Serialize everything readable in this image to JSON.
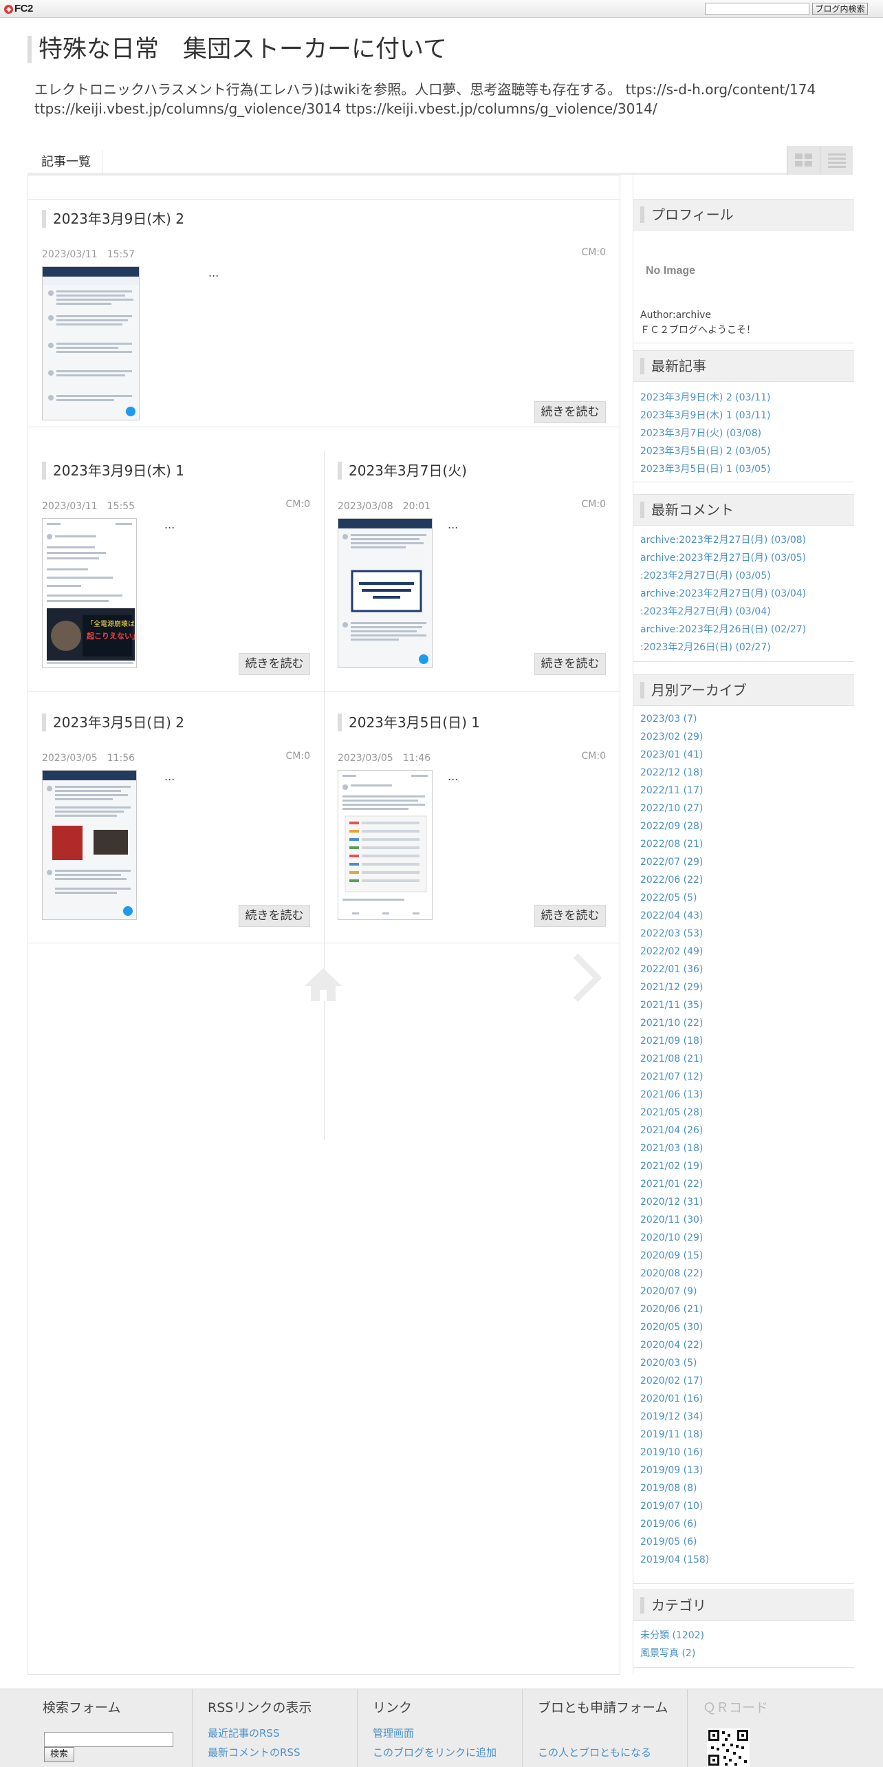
{
  "fc2": {
    "logo": "FC2",
    "search_placeholder": "",
    "search_button": "ブログ内検索"
  },
  "header": {
    "title": "特殊な日常　集団ストーカーに付いて",
    "description": "エレクトロニックハラスメント行為(エレハラ)はwikiを参照。人口夢、思考盗聴等も存在する。 ttps://s-d-h.org/content/174 ttps://keiji.vbest.jp/columns/g_violence/3014 ttps://keiji.vbest.jp/columns/g_violence/3014/"
  },
  "nav": {
    "item": "記事一覧",
    "grid_view": "grid-view-icon",
    "list_view": "list-view-icon"
  },
  "posts": [
    {
      "title": "2023年3月9日(木) 2",
      "date": "2023/03/11　15:57",
      "comments": "CM:0",
      "excerpt": "...",
      "more": "続きを読む"
    },
    {
      "title": "2023年3月9日(木) 1",
      "date": "2023/03/11　15:55",
      "comments": "CM:0",
      "excerpt": "...",
      "more": "続きを読む"
    },
    {
      "title": "2023年3月7日(火)",
      "date": "2023/03/08　20:01",
      "comments": "CM:0",
      "excerpt": "...",
      "more": "続きを読む"
    },
    {
      "title": "2023年3月5日(日) 2",
      "date": "2023/03/05　11:56",
      "comments": "CM:0",
      "excerpt": "...",
      "more": "続きを読む"
    },
    {
      "title": "2023年3月5日(日) 1",
      "date": "2023/03/05　11:46",
      "comments": "CM:0",
      "excerpt": "...",
      "more": "続きを読む"
    }
  ],
  "thumb_text": {
    "poster_line1": "「全電源崩壊は",
    "poster_line2": "起こりえない」"
  },
  "sidebar": {
    "profile": {
      "heading": "プロフィール",
      "no_image": "No Image",
      "author": "Author:archive",
      "welcome": "ＦＣ２ブログへようこそ！"
    },
    "recent_posts": {
      "heading": "最新記事",
      "items": [
        "2023年3月9日(木) 2 (03/11)",
        "2023年3月9日(木) 1 (03/11)",
        "2023年3月7日(火) (03/08)",
        "2023年3月5日(日) 2 (03/05)",
        "2023年3月5日(日) 1 (03/05)"
      ]
    },
    "recent_comments": {
      "heading": "最新コメント",
      "items": [
        "archive:2023年2月27日(月) (03/08)",
        "archive:2023年2月27日(月) (03/05)",
        ":2023年2月27日(月) (03/05)",
        "archive:2023年2月27日(月) (03/04)",
        ":2023年2月27日(月) (03/04)",
        "archive:2023年2月26日(日) (02/27)",
        ":2023年2月26日(日) (02/27)"
      ]
    },
    "archives": {
      "heading": "月別アーカイブ",
      "items": [
        "2023/03 (7)",
        "2023/02 (29)",
        "2023/01 (41)",
        "2022/12 (18)",
        "2022/11 (17)",
        "2022/10 (27)",
        "2022/09 (28)",
        "2022/08 (21)",
        "2022/07 (29)",
        "2022/06 (22)",
        "2022/05 (5)",
        "2022/04 (43)",
        "2022/03 (53)",
        "2022/02 (49)",
        "2022/01 (36)",
        "2021/12 (29)",
        "2021/11 (35)",
        "2021/10 (22)",
        "2021/09 (18)",
        "2021/08 (21)",
        "2021/07 (12)",
        "2021/06 (13)",
        "2021/05 (28)",
        "2021/04 (26)",
        "2021/03 (18)",
        "2021/02 (19)",
        "2021/01 (22)",
        "2020/12 (31)",
        "2020/11 (30)",
        "2020/10 (29)",
        "2020/09 (15)",
        "2020/08 (22)",
        "2020/07 (9)",
        "2020/06 (21)",
        "2020/05 (30)",
        "2020/04 (22)",
        "2020/03 (5)",
        "2020/02 (17)",
        "2020/01 (16)",
        "2019/12 (34)",
        "2019/11 (18)",
        "2019/10 (16)",
        "2019/09 (13)",
        "2019/08 (8)",
        "2019/07 (10)",
        "2019/06 (6)",
        "2019/05 (6)",
        "2019/04 (158)"
      ]
    },
    "categories": {
      "heading": "カテゴリ",
      "items": [
        "未分類 (1202)",
        "風景写真 (2)"
      ]
    }
  },
  "footer": {
    "search": {
      "heading": "検索フォーム",
      "button": "検索"
    },
    "rss": {
      "heading": "RSSリンクの表示",
      "items": [
        "最近記事のRSS",
        "最新コメントのRSS"
      ]
    },
    "links": {
      "heading": "リンク",
      "items": [
        "管理画面",
        "このブログをリンクに追加"
      ]
    },
    "friend": {
      "heading": "ブロとも申請フォーム",
      "items": [
        "この人とブロともになる"
      ]
    },
    "qr": {
      "heading": "ＱＲコード"
    }
  }
}
